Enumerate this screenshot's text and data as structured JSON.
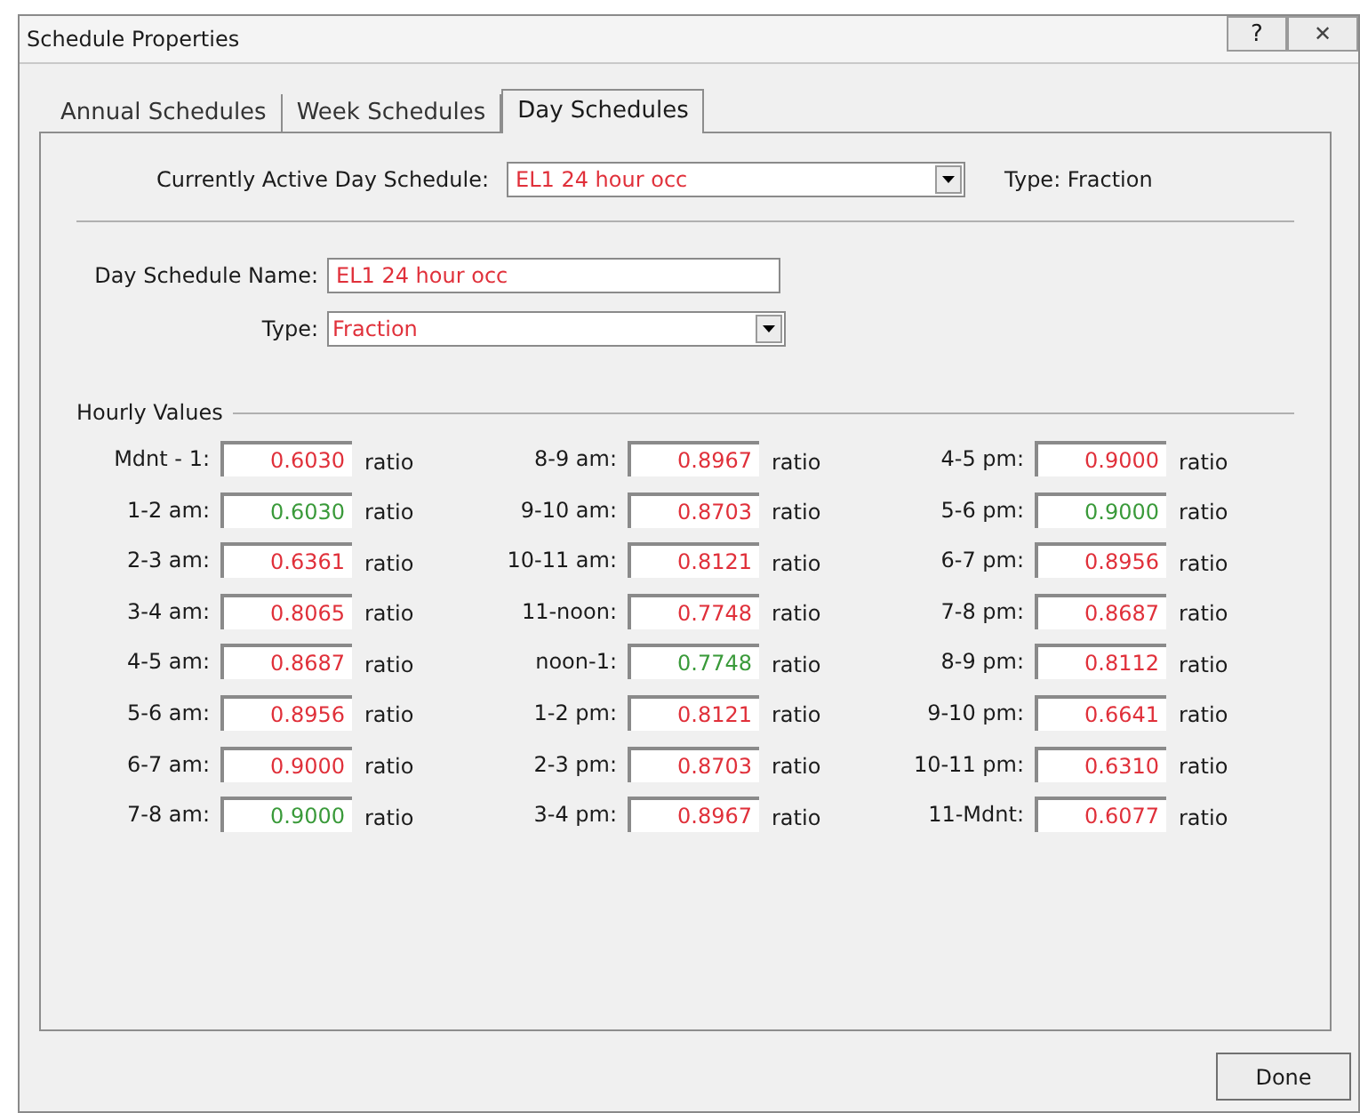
{
  "window": {
    "title": "Schedule Properties",
    "help": "?",
    "close": "✕"
  },
  "tabs": [
    {
      "label": "Annual Schedules",
      "selected": false
    },
    {
      "label": "Week Schedules",
      "selected": false
    },
    {
      "label": "Day Schedules",
      "selected": true
    }
  ],
  "active_schedule": {
    "label": "Currently Active Day Schedule:",
    "value": "EL1 24 hour occ",
    "type_text": "Type: Fraction"
  },
  "name_field": {
    "label": "Day Schedule Name:",
    "value": "EL1 24 hour occ"
  },
  "type_field": {
    "label": "Type:",
    "value": "Fraction"
  },
  "hourly_values": {
    "title": "Hourly Values",
    "columns": [
      [
        {
          "label": "Mdnt - 1:",
          "value": "0.6030",
          "unit": "ratio",
          "color": "#e0303a"
        },
        {
          "label": "1-2 am:",
          "value": "0.6030",
          "unit": "ratio",
          "color": "#3a9a3a"
        },
        {
          "label": "2-3 am:",
          "value": "0.6361",
          "unit": "ratio",
          "color": "#e0303a"
        },
        {
          "label": "3-4 am:",
          "value": "0.8065",
          "unit": "ratio",
          "color": "#e0303a"
        },
        {
          "label": "4-5 am:",
          "value": "0.8687",
          "unit": "ratio",
          "color": "#e0303a"
        },
        {
          "label": "5-6 am:",
          "value": "0.8956",
          "unit": "ratio",
          "color": "#e0303a"
        },
        {
          "label": "6-7 am:",
          "value": "0.9000",
          "unit": "ratio",
          "color": "#e0303a"
        },
        {
          "label": "7-8 am:",
          "value": "0.9000",
          "unit": "ratio",
          "color": "#3a9a3a"
        }
      ],
      [
        {
          "label": "8-9 am:",
          "value": "0.8967",
          "unit": "ratio",
          "color": "#e0303a"
        },
        {
          "label": "9-10 am:",
          "value": "0.8703",
          "unit": "ratio",
          "color": "#e0303a"
        },
        {
          "label": "10-11 am:",
          "value": "0.8121",
          "unit": "ratio",
          "color": "#e0303a"
        },
        {
          "label": "11-noon:",
          "value": "0.7748",
          "unit": "ratio",
          "color": "#e0303a"
        },
        {
          "label": "noon-1:",
          "value": "0.7748",
          "unit": "ratio",
          "color": "#3a9a3a"
        },
        {
          "label": "1-2 pm:",
          "value": "0.8121",
          "unit": "ratio",
          "color": "#e0303a"
        },
        {
          "label": "2-3 pm:",
          "value": "0.8703",
          "unit": "ratio",
          "color": "#e0303a"
        },
        {
          "label": "3-4 pm:",
          "value": "0.8967",
          "unit": "ratio",
          "color": "#e0303a"
        }
      ],
      [
        {
          "label": "4-5 pm:",
          "value": "0.9000",
          "unit": "ratio",
          "color": "#e0303a"
        },
        {
          "label": "5-6 pm:",
          "value": "0.9000",
          "unit": "ratio",
          "color": "#3a9a3a"
        },
        {
          "label": "6-7 pm:",
          "value": "0.8956",
          "unit": "ratio",
          "color": "#e0303a"
        },
        {
          "label": "7-8 pm:",
          "value": "0.8687",
          "unit": "ratio",
          "color": "#e0303a"
        },
        {
          "label": "8-9 pm:",
          "value": "0.8112",
          "unit": "ratio",
          "color": "#e0303a"
        },
        {
          "label": "9-10 pm:",
          "value": "0.6641",
          "unit": "ratio",
          "color": "#e0303a"
        },
        {
          "label": "10-11 pm:",
          "value": "0.6310",
          "unit": "ratio",
          "color": "#e0303a"
        },
        {
          "label": "11-Mdnt:",
          "value": "0.6077",
          "unit": "ratio",
          "color": "#e0303a"
        }
      ]
    ]
  },
  "buttons": [
    {
      "label": "Done"
    }
  ]
}
